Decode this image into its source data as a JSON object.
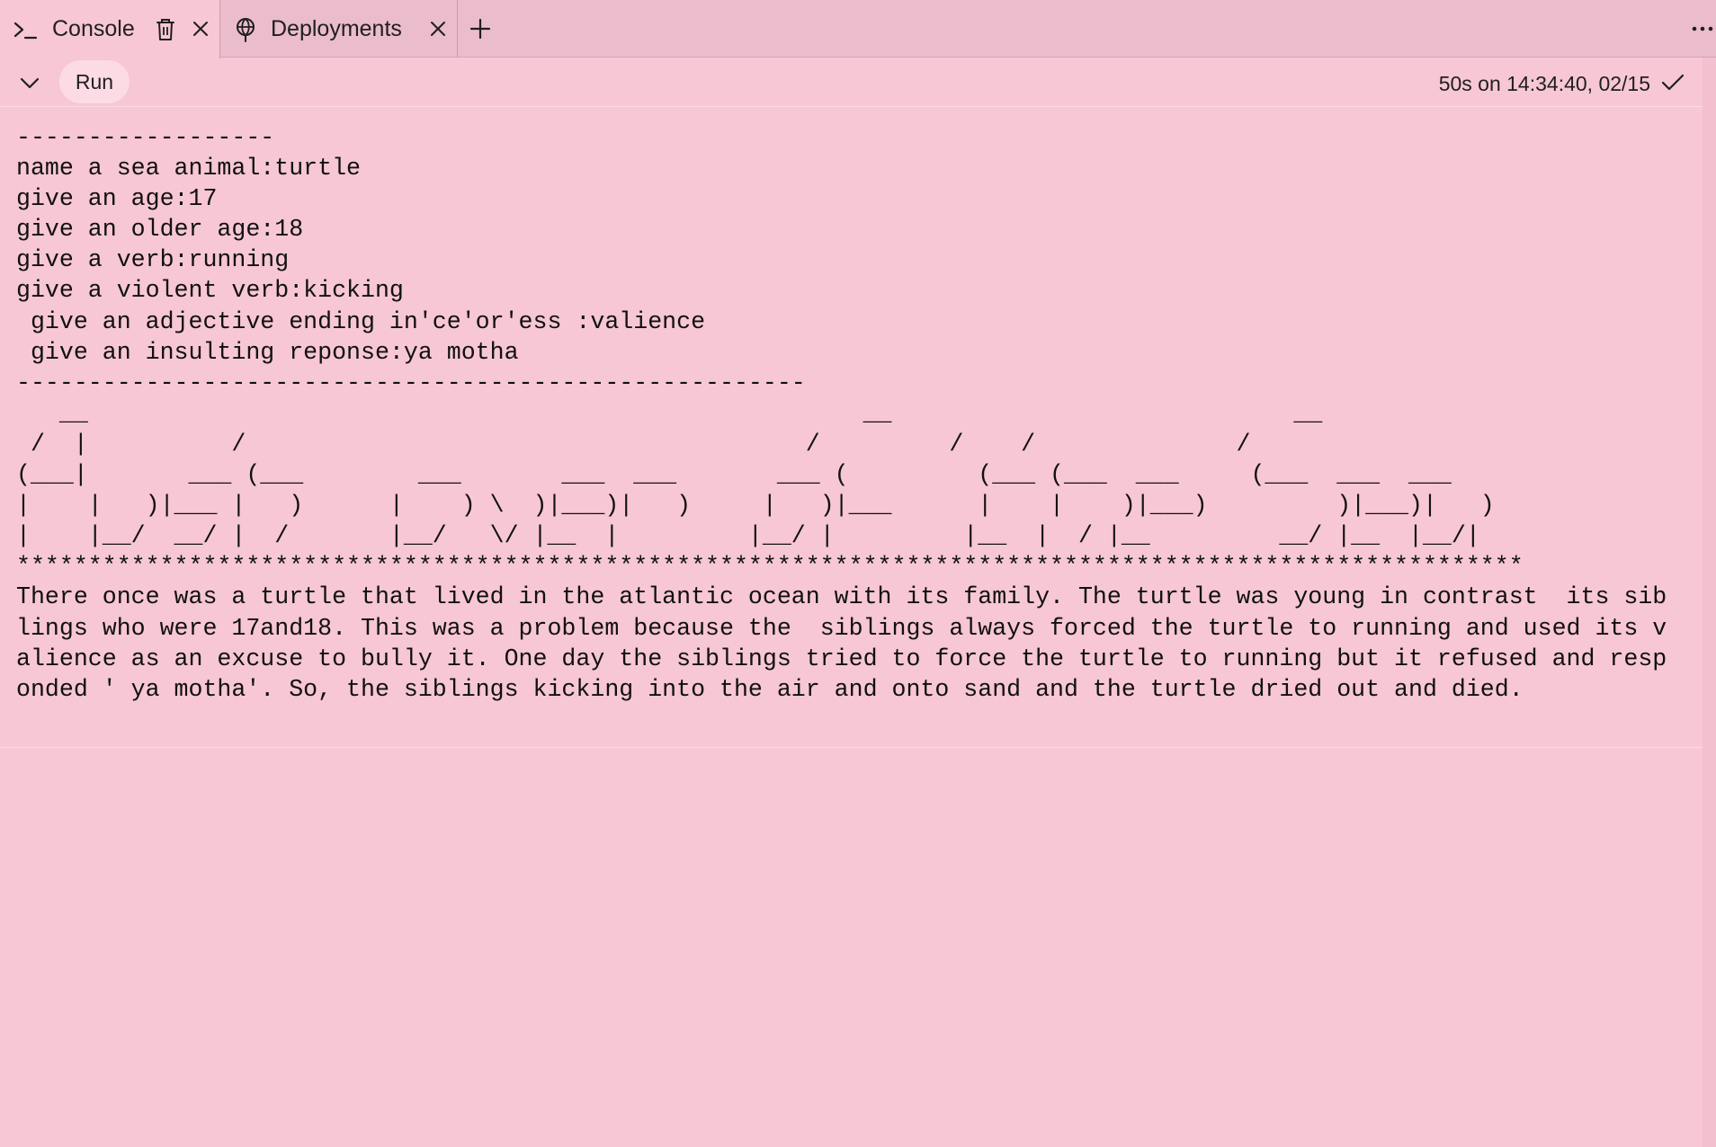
{
  "tabs": [
    {
      "label": "Console",
      "icon": "terminal-icon",
      "active": true
    },
    {
      "label": "Deployments",
      "icon": "deployments-icon",
      "active": false
    }
  ],
  "toolbar": {
    "run_label": "Run",
    "status": "50s on 14:34:40, 02/15"
  },
  "console": {
    "lines": [
      "------------------",
      "name a sea animal:turtle",
      "give an age:17",
      "give an older age:18",
      "give a verb:running",
      "give a violent verb:kicking",
      " give an adjective ending in'ce'or'ess :valience",
      " give an insulting reponse:ya motha",
      "-------------------------------------------------------",
      "   __                                                      __                            __",
      " /  |          /                                       /         /    /              /",
      "(___|       ___ (___        ___       ___  ___       ___ (         (___ (___  ___     (___  ___  ___",
      "|    |   )|___ |   )      |    ) \\  )|___)|   )     |   )|___      |    |    )|___)         )|___)|   )",
      "|    |__/  __/ |  /       |__/   \\/ |__  |         |__/ |         |__  |  / |__         __/ |__  |__/|",
      "*********************************************************************************************************",
      "There once was a turtle that lived in the atlantic ocean with its family. The turtle was young in contrast  its sib",
      "lings who were 17and18. This was a problem because the  siblings always forced the turtle to running and used its v",
      "alience as an excuse to bully it. One day the siblings tried to force the turtle to running but it refused and resp",
      "onded ' ya motha'. So, the siblings kicking into the air and onto sand and the turtle dried out and died."
    ]
  }
}
